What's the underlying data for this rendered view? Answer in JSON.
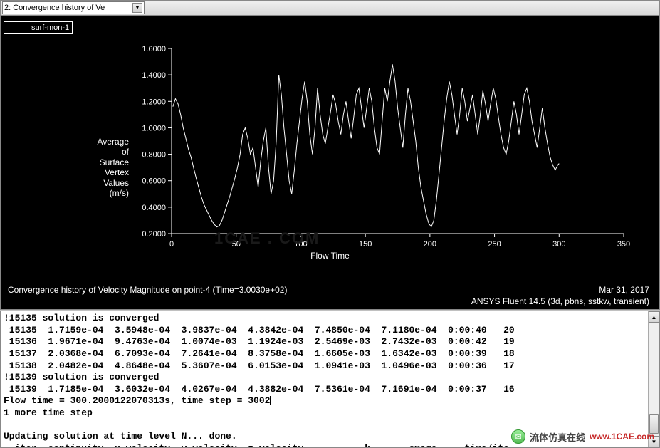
{
  "toolbar": {
    "dropdown_value": "2: Convergence history of Ve"
  },
  "legend": {
    "series_name": "surf-mon-1"
  },
  "axes": {
    "ylabel": "Average\nof\nSurface\nVertex\nValues\n(m/s)",
    "xlabel": "Flow Time"
  },
  "caption": {
    "left": "Convergence history of Velocity Magnitude on point-4  (Time=3.0030e+02)",
    "right_date": "Mar 31, 2017",
    "right_solver": "ANSYS Fluent 14.5 (3d, pbns, sstkw, transient)"
  },
  "watermark": "1CAE . COM",
  "console_lines": [
    "!15135 solution is converged",
    " 15135  1.7159e-04  3.5948e-04  3.9837e-04  4.3842e-04  7.4850e-04  7.1180e-04  0:00:40   20",
    " 15136  1.9671e-04  9.4763e-04  1.0074e-03  1.1924e-03  2.5469e-03  2.7432e-03  0:00:42   19",
    " 15137  2.0368e-04  6.7093e-04  7.2641e-04  8.3758e-04  1.6605e-03  1.6342e-03  0:00:39   18",
    " 15138  2.0482e-04  4.8648e-04  5.3607e-04  6.0153e-04  1.0941e-03  1.0496e-03  0:00:36   17",
    "!15139 solution is converged",
    " 15139  1.7185e-04  3.6032e-04  4.0267e-04  4.3882e-04  7.5361e-04  7.1691e-04  0:00:37   16",
    "Flow time = 300.2000122070313s, time step = 3002",
    "1 more time step",
    "",
    "Updating solution at time level N... done.",
    "  iter  continuity  x-velocity  y-velocity  z-velocity           k       omega     time/ite"
  ],
  "footer_wm": {
    "cn": "流体仿真在线",
    "url": "www.1CAE.com"
  },
  "chart_data": {
    "type": "line",
    "title": "Convergence history of Velocity Magnitude on point-4",
    "xlabel": "Flow Time",
    "ylabel": "Average of Surface Vertex Values (m/s)",
    "xlim": [
      0,
      350
    ],
    "ylim": [
      0.2,
      1.6
    ],
    "x_ticks": [
      0,
      50,
      100,
      150,
      200,
      250,
      300,
      350
    ],
    "y_ticks": [
      0.2,
      0.4,
      0.6,
      0.8,
      1.0,
      1.2,
      1.4,
      1.6
    ],
    "series": [
      {
        "name": "surf-mon-1",
        "x": [
          1,
          3,
          5,
          7,
          9,
          11,
          13,
          15,
          17,
          19,
          21,
          23,
          25,
          27,
          29,
          31,
          33,
          35,
          37,
          39,
          41,
          43,
          45,
          47,
          49,
          51,
          53,
          55,
          57,
          59,
          61,
          63,
          65,
          67,
          69,
          71,
          73,
          75,
          77,
          79,
          81,
          83,
          85,
          87,
          89,
          91,
          93,
          95,
          97,
          99,
          101,
          103,
          105,
          107,
          109,
          111,
          113,
          115,
          117,
          119,
          121,
          123,
          125,
          127,
          129,
          131,
          133,
          135,
          137,
          139,
          141,
          143,
          145,
          147,
          149,
          151,
          153,
          155,
          157,
          159,
          161,
          163,
          165,
          167,
          169,
          171,
          173,
          175,
          177,
          179,
          181,
          183,
          185,
          187,
          189,
          191,
          193,
          195,
          197,
          199,
          201,
          203,
          205,
          207,
          209,
          211,
          213,
          215,
          217,
          219,
          221,
          223,
          225,
          227,
          229,
          231,
          233,
          235,
          237,
          239,
          241,
          243,
          245,
          247,
          249,
          251,
          253,
          255,
          257,
          259,
          261,
          263,
          265,
          267,
          269,
          271,
          273,
          275,
          277,
          279,
          281,
          283,
          285,
          287,
          289,
          291,
          293,
          295,
          297,
          299,
          300
        ],
        "values": [
          1.16,
          1.22,
          1.18,
          1.1,
          1.0,
          0.92,
          0.84,
          0.78,
          0.7,
          0.62,
          0.55,
          0.48,
          0.42,
          0.38,
          0.34,
          0.3,
          0.27,
          0.25,
          0.26,
          0.3,
          0.36,
          0.42,
          0.48,
          0.55,
          0.62,
          0.7,
          0.8,
          0.95,
          1.0,
          0.92,
          0.8,
          0.85,
          0.7,
          0.55,
          0.75,
          0.9,
          1.0,
          0.7,
          0.5,
          0.6,
          0.9,
          1.4,
          1.25,
          1.0,
          0.8,
          0.6,
          0.5,
          0.68,
          0.88,
          1.05,
          1.22,
          1.35,
          1.2,
          0.95,
          0.8,
          1.0,
          1.3,
          1.1,
          0.95,
          0.88,
          1.0,
          1.12,
          1.25,
          1.18,
          1.05,
          0.95,
          1.1,
          1.2,
          1.05,
          0.92,
          1.08,
          1.25,
          1.3,
          1.15,
          1.0,
          1.15,
          1.3,
          1.2,
          1.0,
          0.85,
          0.8,
          1.05,
          1.3,
          1.2,
          1.35,
          1.48,
          1.35,
          1.15,
          1.0,
          0.85,
          1.1,
          1.3,
          1.2,
          1.05,
          0.9,
          0.7,
          0.55,
          0.45,
          0.35,
          0.28,
          0.25,
          0.3,
          0.45,
          0.65,
          0.85,
          1.05,
          1.22,
          1.35,
          1.25,
          1.1,
          0.95,
          1.1,
          1.3,
          1.2,
          1.05,
          1.15,
          1.25,
          1.1,
          0.95,
          1.1,
          1.28,
          1.18,
          1.05,
          1.18,
          1.3,
          1.22,
          1.08,
          0.95,
          0.85,
          0.8,
          0.9,
          1.05,
          1.2,
          1.1,
          0.95,
          1.1,
          1.25,
          1.3,
          1.2,
          1.05,
          0.95,
          0.85,
          1.0,
          1.15,
          1.0,
          0.88,
          0.78,
          0.72,
          0.68,
          0.72,
          0.73
        ]
      }
    ]
  }
}
